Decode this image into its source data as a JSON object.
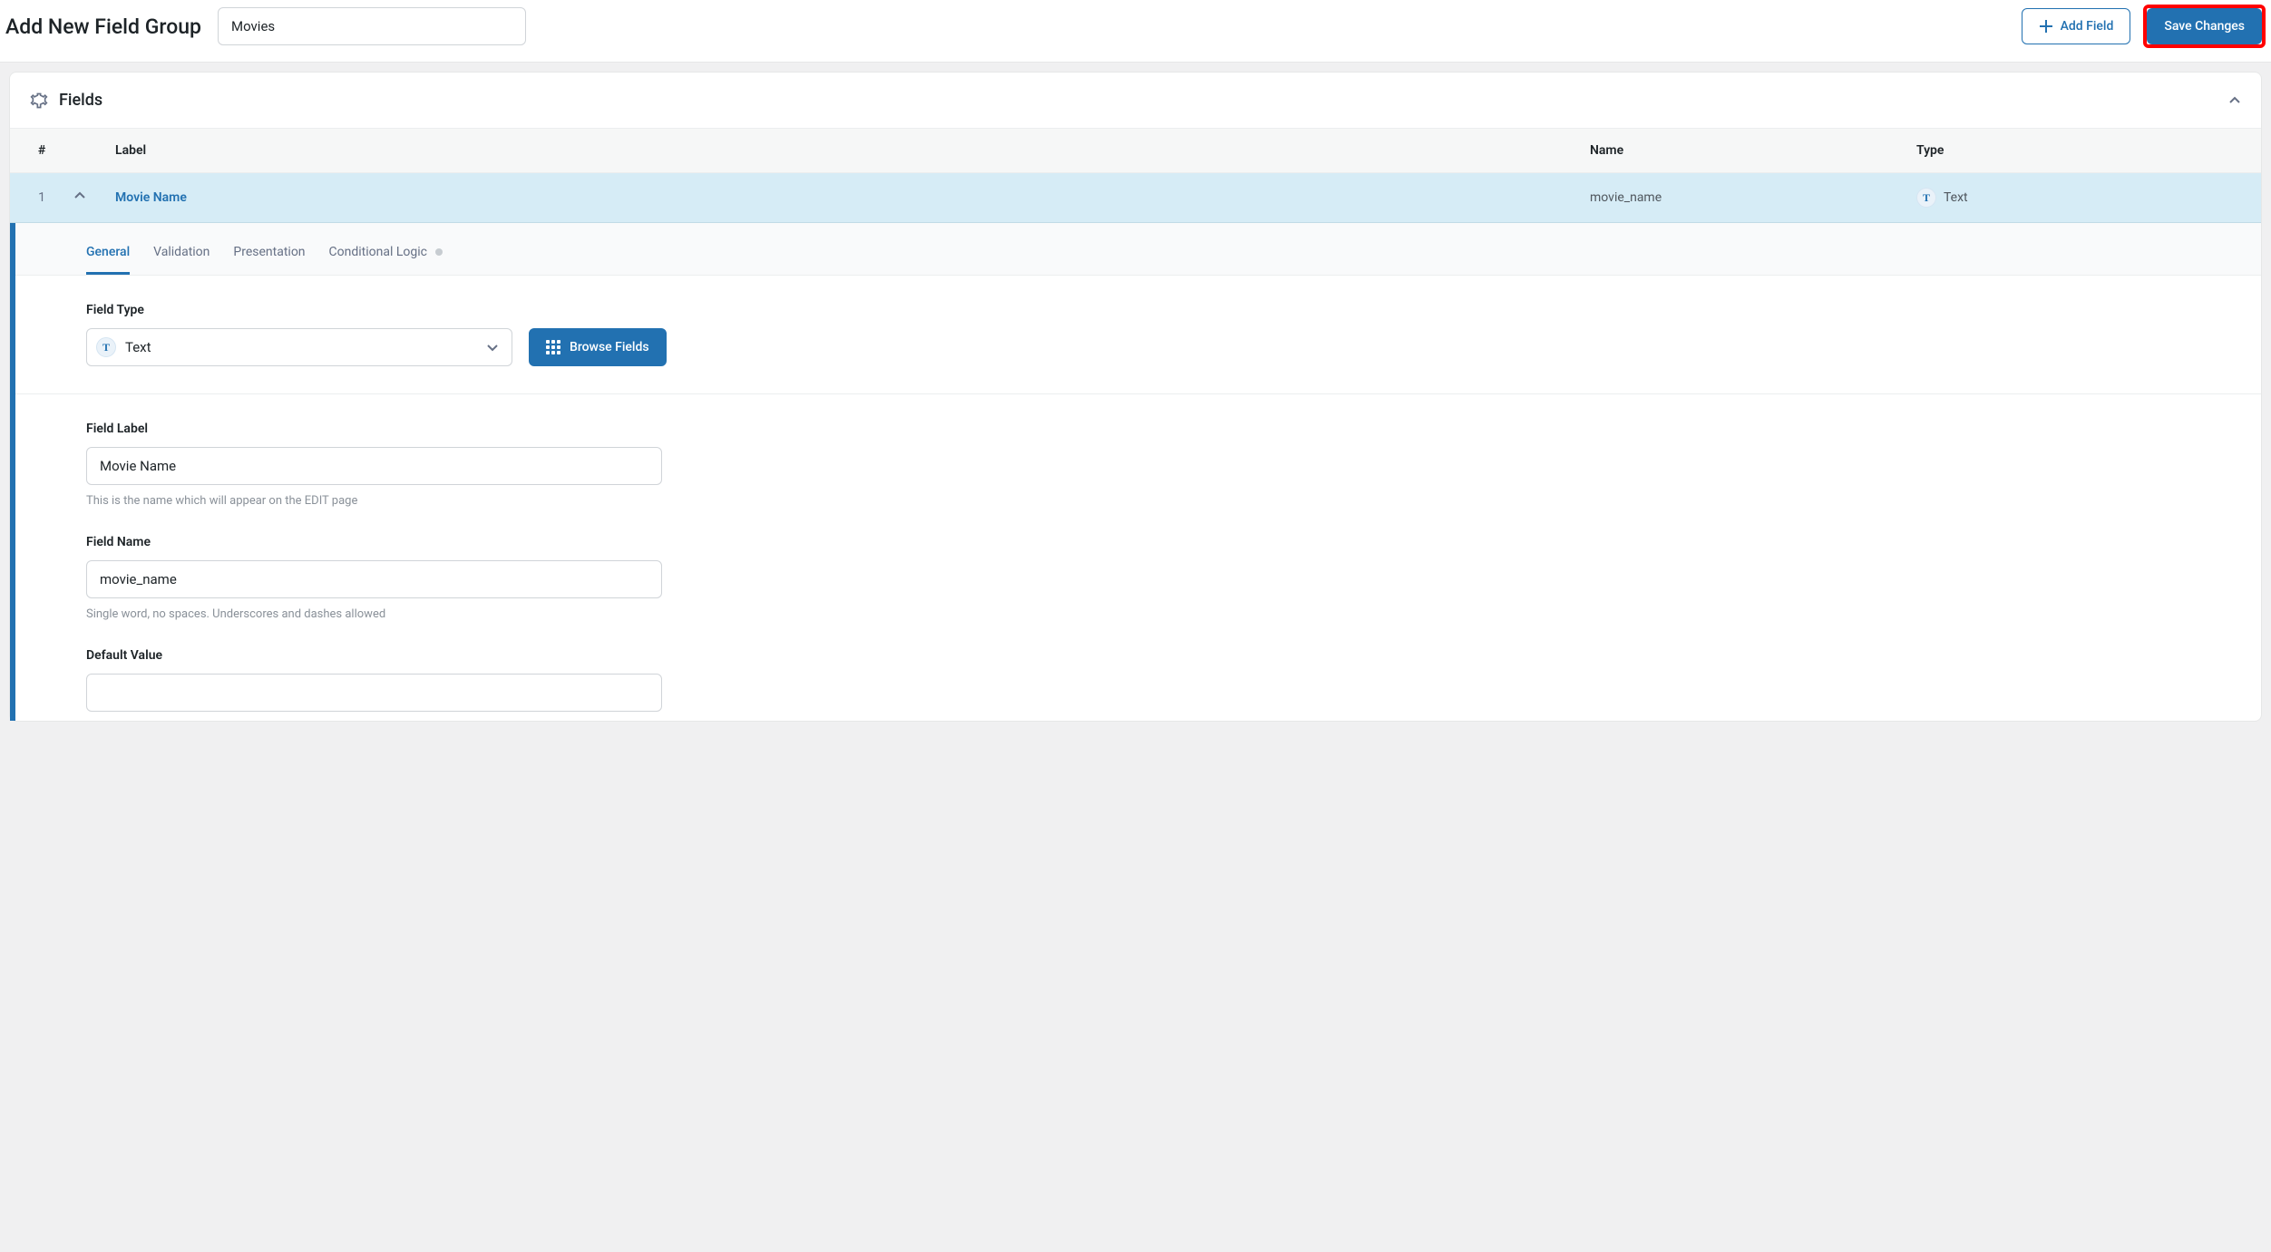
{
  "header": {
    "page_title": "Add New Field Group",
    "title_input_value": "Movies",
    "add_field_label": "Add Field",
    "save_label": "Save Changes"
  },
  "panel": {
    "title": "Fields",
    "columns": {
      "num": "#",
      "label": "Label",
      "name": "Name",
      "type": "Type"
    },
    "row": {
      "num": "1",
      "label": "Movie Name",
      "name": "movie_name",
      "type_text": "Text",
      "type_badge": "T"
    },
    "tabs": {
      "general": "General",
      "validation": "Validation",
      "presentation": "Presentation",
      "conditional": "Conditional Logic"
    },
    "field_type": {
      "label": "Field Type",
      "selected_text": "Text",
      "selected_badge": "T",
      "browse_label": "Browse Fields"
    },
    "field_label": {
      "label": "Field Label",
      "value": "Movie Name",
      "help": "This is the name which will appear on the EDIT page"
    },
    "field_name": {
      "label": "Field Name",
      "value": "movie_name",
      "help": "Single word, no spaces. Underscores and dashes allowed"
    },
    "default_value": {
      "label": "Default Value",
      "value": ""
    }
  }
}
